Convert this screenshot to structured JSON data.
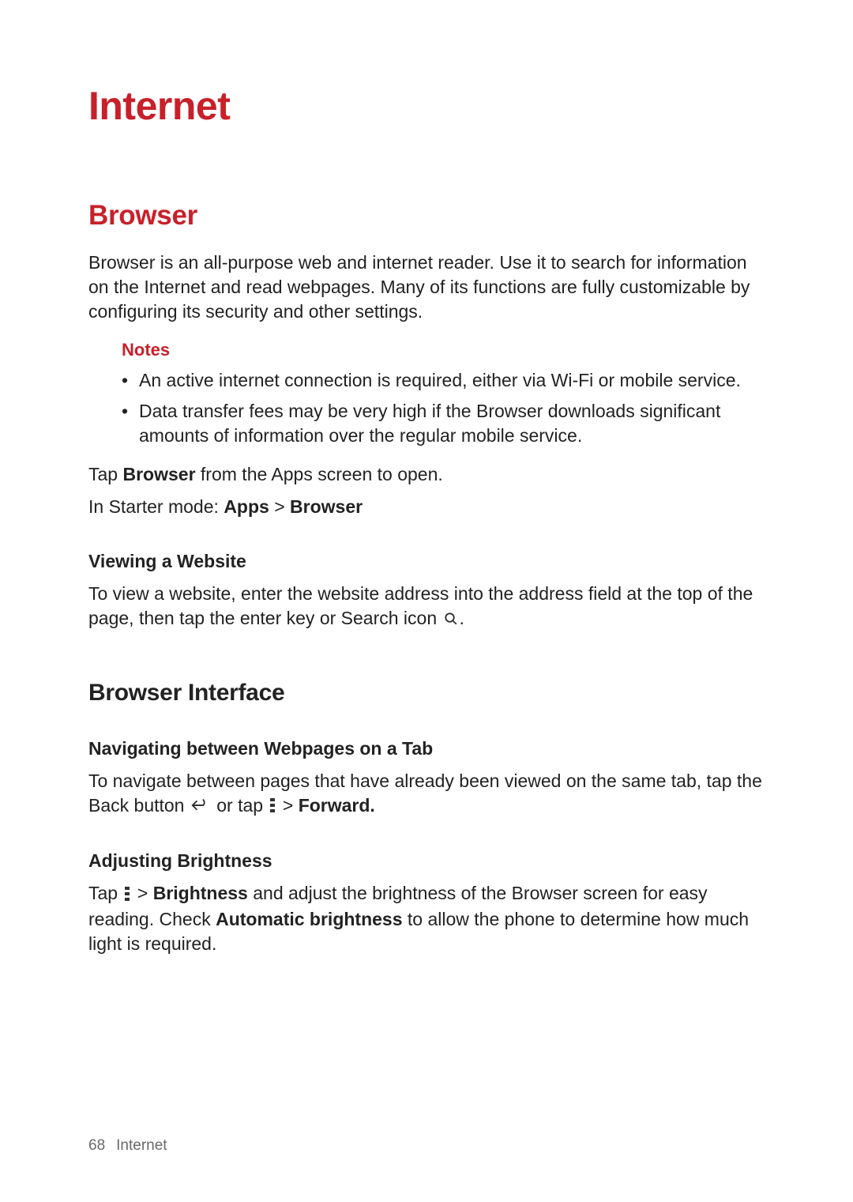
{
  "chapter_title": "Internet",
  "section_browser": {
    "title": "Browser",
    "intro": "Browser is an all-purpose web and internet reader. Use it to search for information on the Internet and read webpages. Many of its functions are fully customizable by configuring its security and other settings.",
    "notes_heading": "Notes",
    "notes": [
      "An active internet connection is required, either via Wi-Fi or mobile service.",
      "Data transfer fees may be very high if the Browser downloads significant amounts of information over the regular mobile service."
    ],
    "tap_browser": {
      "pre": "Tap ",
      "bold": "Browser",
      "post": " from the Apps screen to open."
    },
    "starter_mode": {
      "pre": "In Starter mode: ",
      "bold1": "Apps",
      "mid": " > ",
      "bold2": "Browser"
    },
    "viewing_heading": "Viewing a Website",
    "viewing_text_pre": "To view a website, enter the website address into the address field at the top of the page, then tap the enter key or Search icon ",
    "viewing_text_post": "."
  },
  "section_interface": {
    "title": "Browser Interface",
    "nav_heading": "Navigating between Webpages on a Tab",
    "nav": {
      "pre": "To navigate between pages that have already been viewed on the same tab, tap the Back button ",
      "mid": " or tap ",
      "gt": " > ",
      "bold": "Forward."
    },
    "brightness_heading": "Adjusting Brightness",
    "brightness": {
      "pre": "Tap ",
      "gt": " > ",
      "bold1": "Brightness",
      "mid1": " and adjust the brightness of the Browser screen for easy reading. Check ",
      "bold2": "Automatic brightness",
      "post": " to allow the phone to determine how much light is required."
    }
  },
  "footer": {
    "page_number": "68",
    "section": "Internet"
  }
}
